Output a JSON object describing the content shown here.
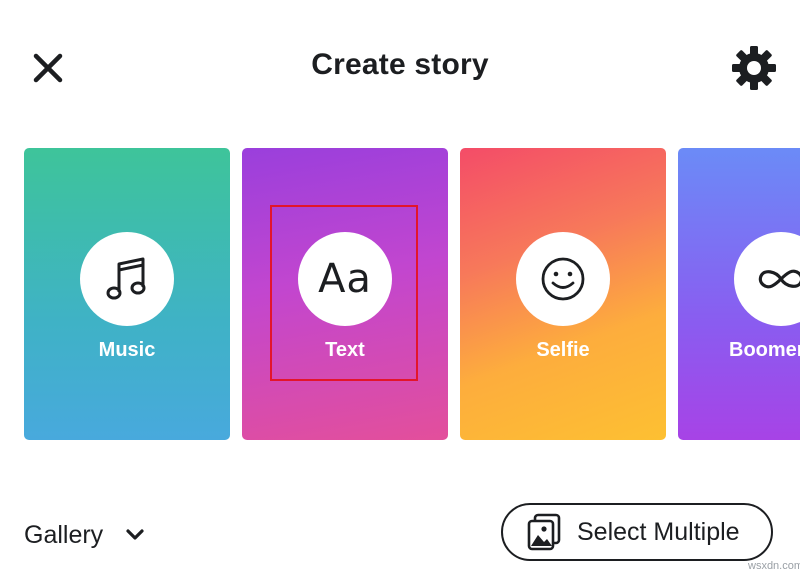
{
  "header": {
    "title": "Create story",
    "close_icon": "close-icon",
    "settings_icon": "gear-icon"
  },
  "cards": [
    {
      "label": "Music",
      "icon": "music-note-icon",
      "color_top": "#3ec49a",
      "color_bottom": "#48a9dd"
    },
    {
      "label": "Text",
      "icon": "text-aa-icon",
      "glyph": "Aa",
      "color_top": "#9a3fdc",
      "color_bottom": "#e34f9b",
      "highlighted": true
    },
    {
      "label": "Selfie",
      "icon": "smiley-icon",
      "color_top": "#f44c68",
      "color_bottom": "#fdc032"
    },
    {
      "label": "Boomer",
      "icon": "infinity-icon",
      "color_top": "#6b8bf7",
      "color_bottom": "#a743e6"
    }
  ],
  "highlight_color": "#e3152b",
  "gallery": {
    "label": "Gallery",
    "icon": "chevron-down-icon"
  },
  "select_multiple": {
    "label": "Select Multiple",
    "icon": "gallery-stack-icon"
  },
  "watermark": "wsxdn.com"
}
